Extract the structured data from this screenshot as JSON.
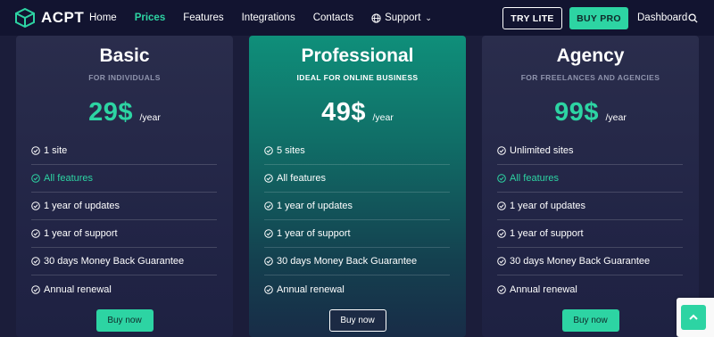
{
  "brand": {
    "name": "ACPT",
    "color_accent": "#2dd4a3"
  },
  "nav": {
    "links": [
      {
        "label": "Home"
      },
      {
        "label": "Prices",
        "active": true
      },
      {
        "label": "Features"
      },
      {
        "label": "Integrations"
      },
      {
        "label": "Contacts"
      }
    ],
    "support_label": "Support",
    "try_lite": "TRY LITE",
    "buy_pro": "BUY PRO",
    "dashboard": "Dashboard"
  },
  "plans": [
    {
      "name": "Basic",
      "subtitle": "FOR INDIVIDUALS",
      "price": "29$",
      "period": "/year",
      "features": [
        "1 site",
        "All features",
        "1 year of updates",
        "1 year of support",
        "30 days Money Back Guarantee",
        "Annual renewal"
      ],
      "button": "Buy now"
    },
    {
      "name": "Professional",
      "subtitle": "IDEAL FOR ONLINE BUSINESS",
      "price": "49$",
      "period": "/year",
      "features": [
        "5 sites",
        "All features",
        "1 year of updates",
        "1 year of support",
        "30 days Money Back Guarantee",
        "Annual renewal"
      ],
      "button": "Buy now"
    },
    {
      "name": "Agency",
      "subtitle": "FOR FREELANCES AND AGENCIES",
      "price": "99$",
      "period": "/year",
      "features": [
        "Unlimited sites",
        "All features",
        "1 year of updates",
        "1 year of support",
        "30 days Money Back Guarantee",
        "Annual renewal"
      ],
      "button": "Buy now"
    }
  ],
  "icons": {
    "logo": "cube-logo-icon",
    "support": "globe-icon",
    "search": "search-icon",
    "feature": "check-circle-icon",
    "scroll_top": "arrow-up-icon"
  }
}
